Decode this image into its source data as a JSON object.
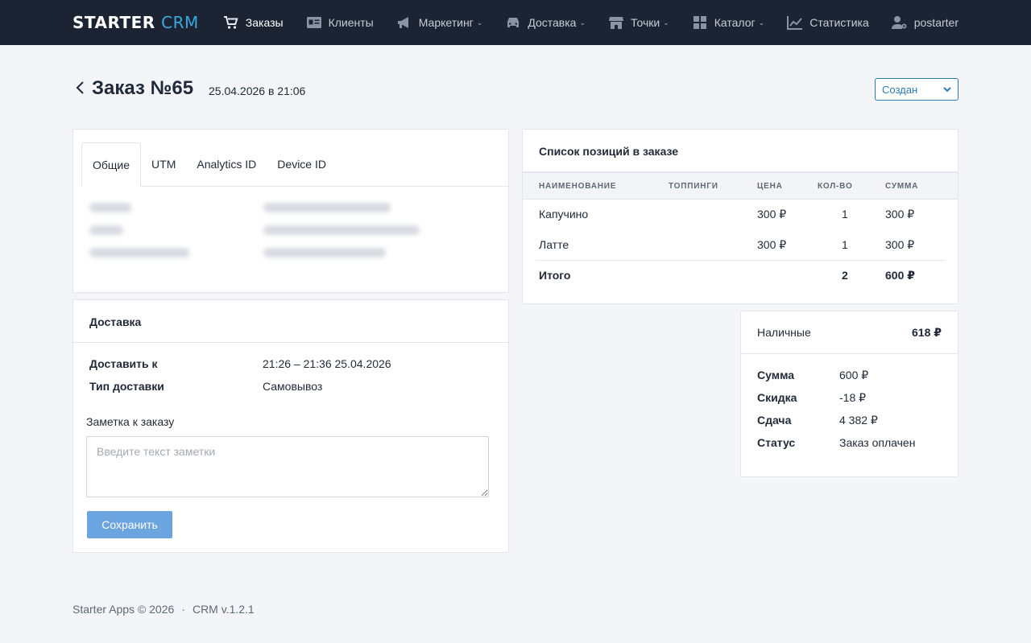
{
  "app": {
    "logo_main": "STARTER",
    "logo_accent": "CRM"
  },
  "nav": {
    "orders": "Заказы",
    "clients": "Клиенты",
    "marketing": "Маркетинг",
    "delivery": "Доставка",
    "points": "Точки",
    "catalog": "Каталог",
    "stats": "Статистика",
    "user": "postarter"
  },
  "page": {
    "title": "Заказ №65",
    "date": "25.04.2026 в 21:06",
    "status": "Создан"
  },
  "general": {
    "tabs": [
      "Общие",
      "UTM",
      "Analytics ID",
      "Device ID"
    ]
  },
  "delivery": {
    "header": "Доставка",
    "deliver_to_label": "Доставить к",
    "deliver_to_value": "21:26 – 21:36  25.04.2026",
    "type_label": "Тип доставки",
    "type_value": "Самовывоз",
    "note_label": "Заметка к заказу",
    "note_placeholder": "Введите текст заметки",
    "save_label": "Сохранить"
  },
  "items": {
    "header": "Список позиций в заказе",
    "columns": [
      "НАИМЕНОВАНИЕ",
      "ТОППИНГИ",
      "ЦЕНА",
      "КОЛ-ВО",
      "СУММА"
    ],
    "rows": [
      {
        "name": "Капучино",
        "toppings": "",
        "price": "300 ₽",
        "qty": "1",
        "sum": "300 ₽"
      },
      {
        "name": "Латте",
        "toppings": "",
        "price": "300 ₽",
        "qty": "1",
        "sum": "300 ₽"
      }
    ],
    "total_label": "Итого",
    "total_qty": "2",
    "total_sum": "600 ₽"
  },
  "payment": {
    "method": "Наличные",
    "amount": "618 ₽",
    "sum_label": "Сумма",
    "sum_value": "600 ₽",
    "discount_label": "Скидка",
    "discount_value": "-18 ₽",
    "change_label": "Сдача",
    "change_value": "4 382 ₽",
    "status_label": "Статус",
    "status_value": "Заказ оплачен"
  },
  "footer": {
    "copyright": "Starter Apps © 2026",
    "version": "CRM v.1.2.1"
  },
  "colors": {
    "topbar": "#1c2434",
    "accent": "#3aa8e0",
    "status_border": "#2b7bb5",
    "save_button": "#6ca4e0"
  }
}
